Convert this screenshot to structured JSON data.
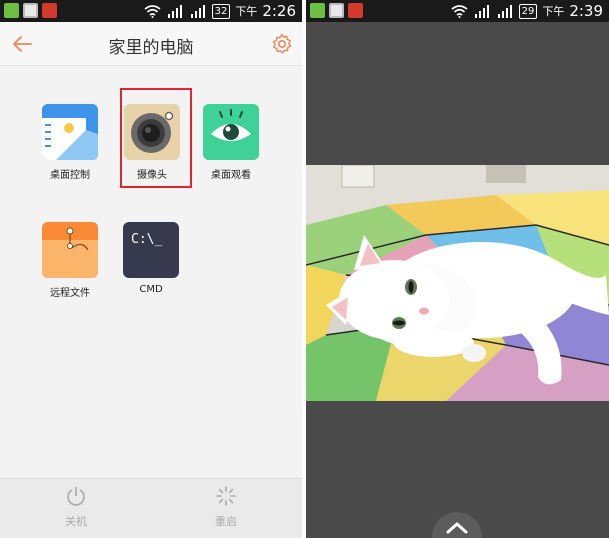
{
  "left_screen": {
    "status_bar": {
      "battery": "32",
      "ampm": "下午",
      "time": "2:26"
    },
    "app_bar": {
      "title": "家里的电脑"
    },
    "tiles": [
      {
        "label": "桌面控制"
      },
      {
        "label": "摄像头"
      },
      {
        "label": "桌面观看"
      },
      {
        "label": "远程文件"
      },
      {
        "label": "CMD",
        "icon_text": "C:\\_"
      }
    ],
    "highlighted_tile": "摄像头",
    "bottom_bar": {
      "shutdown_label": "关机",
      "restart_label": "重启"
    }
  },
  "right_screen": {
    "status_bar": {
      "battery": "29",
      "ampm": "下午",
      "time": "2:39"
    },
    "camera_view": {
      "subject": "white cat lying on colorful patchwork blanket"
    }
  },
  "colors": {
    "accent": "#f0855a",
    "highlight_border": "#e0252b",
    "desktop_control_icon": "#3d94e8",
    "camera_icon": "#e8d3a8",
    "desktop_view_icon": "#3fd197",
    "remote_files_icon": "#f9a24b",
    "cmd_icon": "#373a4d"
  }
}
